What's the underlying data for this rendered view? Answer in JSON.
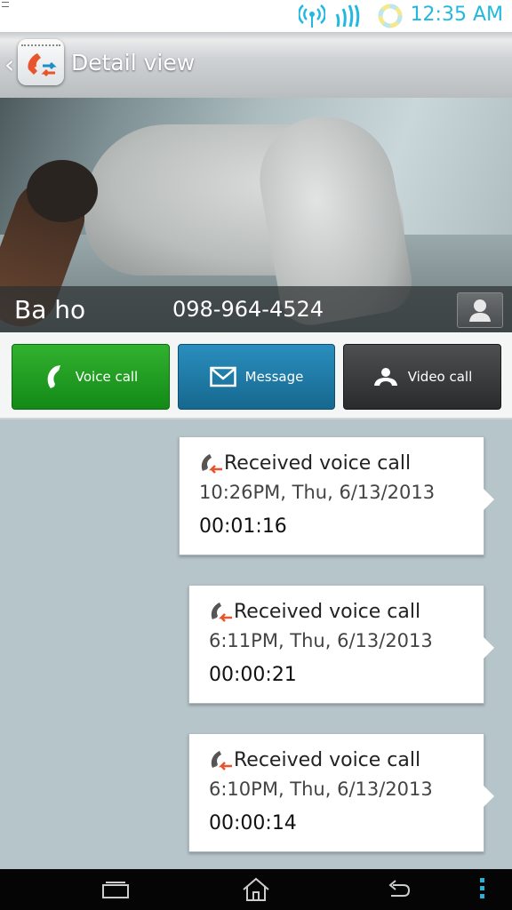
{
  "status_bar": {
    "time": "12:35 AM",
    "icons": [
      "wifi-hotspot-icon",
      "signal-icon",
      "sync-icon"
    ]
  },
  "app_bar": {
    "title": "Detail view",
    "icon": "call-log-app-icon"
  },
  "contact": {
    "name": "Ba ho",
    "phone": "098-964-4524"
  },
  "actions": [
    {
      "label": "Voice call",
      "icon": "phone-icon",
      "color": "#1f9e22"
    },
    {
      "label": "Message",
      "icon": "envelope-icon",
      "color": "#1e7ca9"
    },
    {
      "label": "Video call",
      "icon": "person-icon",
      "color": "#3b3c3d"
    }
  ],
  "call_log": [
    {
      "type": "Received voice call",
      "datetime": "10:26PM, Thu, 6/13/2013",
      "duration": "00:01:16"
    },
    {
      "type": "Received voice call",
      "datetime": "6:11PM, Thu, 6/13/2013",
      "duration": "00:00:21"
    },
    {
      "type": "Received voice call",
      "datetime": "6:10PM, Thu, 6/13/2013",
      "duration": "00:00:14"
    }
  ],
  "nav_bar": {
    "buttons": [
      "recent-apps-icon",
      "home-icon",
      "back-icon",
      "menu-icon"
    ]
  }
}
